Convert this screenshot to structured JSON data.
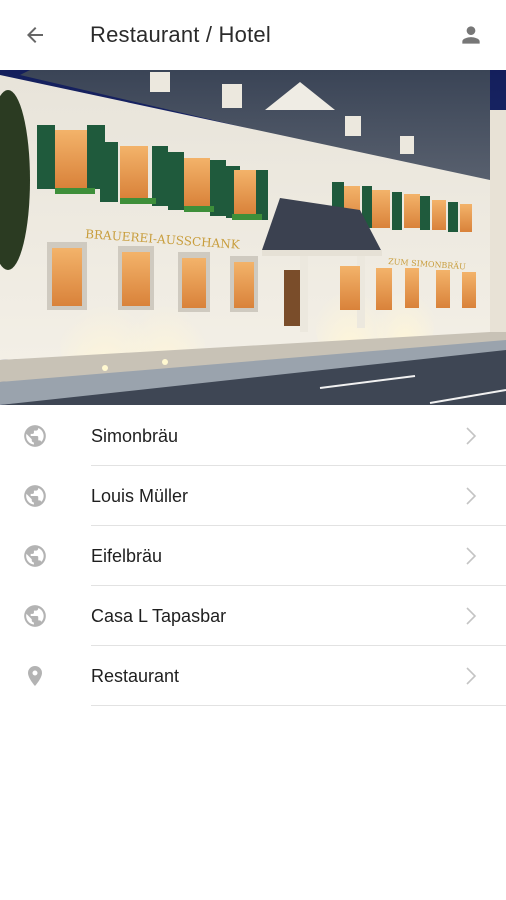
{
  "header": {
    "title": "Restaurant / Hotel",
    "back_icon": "arrow-left-icon",
    "account_icon": "person-icon"
  },
  "hero": {
    "sign_main": "BRAUEREI-AUSSCHANK",
    "sign_entrance": "ZUM SIMONBRÄU"
  },
  "items": [
    {
      "label": "Simonbräu",
      "icon": "globe-icon"
    },
    {
      "label": "Louis Müller",
      "icon": "globe-icon"
    },
    {
      "label": "Eifelbräu",
      "icon": "globe-icon"
    },
    {
      "label": "Casa L Tapasbar",
      "icon": "globe-icon"
    },
    {
      "label": "Restaurant",
      "icon": "map-pin-icon"
    }
  ],
  "colors": {
    "icon_gray": "#b3b3b3",
    "text": "#1f1f1f",
    "divider": "#e2e2e2"
  }
}
